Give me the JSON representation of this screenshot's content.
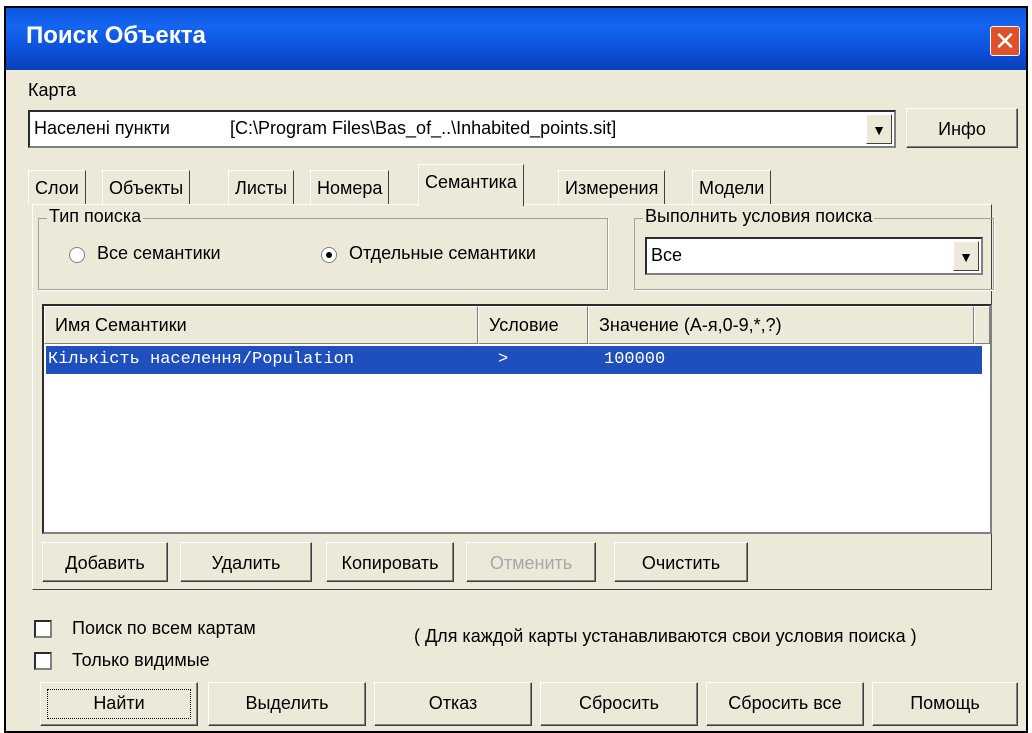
{
  "window": {
    "title": "Поиск Объекта"
  },
  "map": {
    "label": "Карта",
    "name": "Населені пункти",
    "path": "[C:\\Program Files\\Bas_of_..\\Inhabited_points.sit]",
    "info_button": "Инфо"
  },
  "tabs": [
    "Слои",
    "Объекты",
    "Листы",
    "Номера",
    "Семантика",
    "Измерения",
    "Модели"
  ],
  "active_tab": "Семантика",
  "search_type": {
    "label": "Тип поиска",
    "options": [
      "Все семантики",
      "Отдельные семантики"
    ],
    "selected": "Отдельные семантики"
  },
  "conditions": {
    "label": "Выполнить условия поиска",
    "value": "Все"
  },
  "table": {
    "columns": [
      "Имя Семантики",
      "Условие",
      "Значение  (А-я,0-9,*,?)"
    ],
    "rows": [
      {
        "name": "Кількість населення/Population",
        "condition": ">",
        "value": "100000"
      }
    ]
  },
  "table_buttons": {
    "add": "Добавить",
    "delete": "Удалить",
    "copy": "Копировать",
    "cancel": "Отменить",
    "clear": "Очистить"
  },
  "options": {
    "all_maps": "Поиск по всем картам",
    "visible_only": "Только видимые",
    "note": "( Для каждой карты устанавливаются свои условия поиска )"
  },
  "bottom_buttons": {
    "find": "Найти",
    "select": "Выделить",
    "cancel": "Отказ",
    "reset": "Сбросить",
    "reset_all": "Сбросить все",
    "help": "Помощь"
  }
}
